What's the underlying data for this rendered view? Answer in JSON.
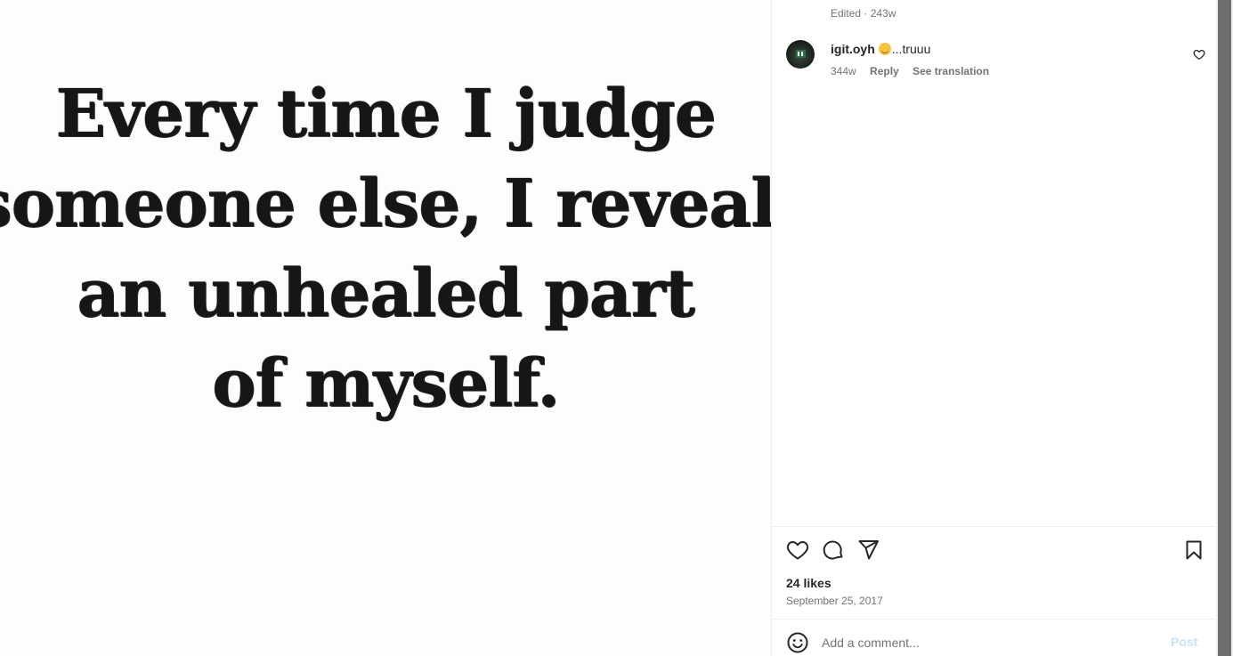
{
  "post": {
    "quote_lines": [
      "Every time I judge",
      "someone else, I reveal",
      "an unhealed part",
      "of myself."
    ],
    "edited": "Edited · 243w",
    "likes": "24 likes",
    "date": "September 25, 2017"
  },
  "comments": [
    {
      "username": "igit.oyh",
      "text": "...truuu",
      "age": "344w",
      "reply_label": "Reply",
      "translation_label": "See translation"
    }
  ],
  "add_comment": {
    "placeholder": "Add a comment...",
    "post_label": "Post"
  },
  "icons": {
    "like": "heart-icon",
    "comment": "comment-bubble-icon",
    "share": "paper-plane-icon",
    "save": "bookmark-icon",
    "emoji": "smiley-face-icon",
    "comment_like": "small-heart-icon"
  },
  "colors": {
    "text_primary": "#262626",
    "text_secondary": "#737373",
    "post_button_disabled": "#c6e2fb",
    "divider": "#efefef"
  }
}
